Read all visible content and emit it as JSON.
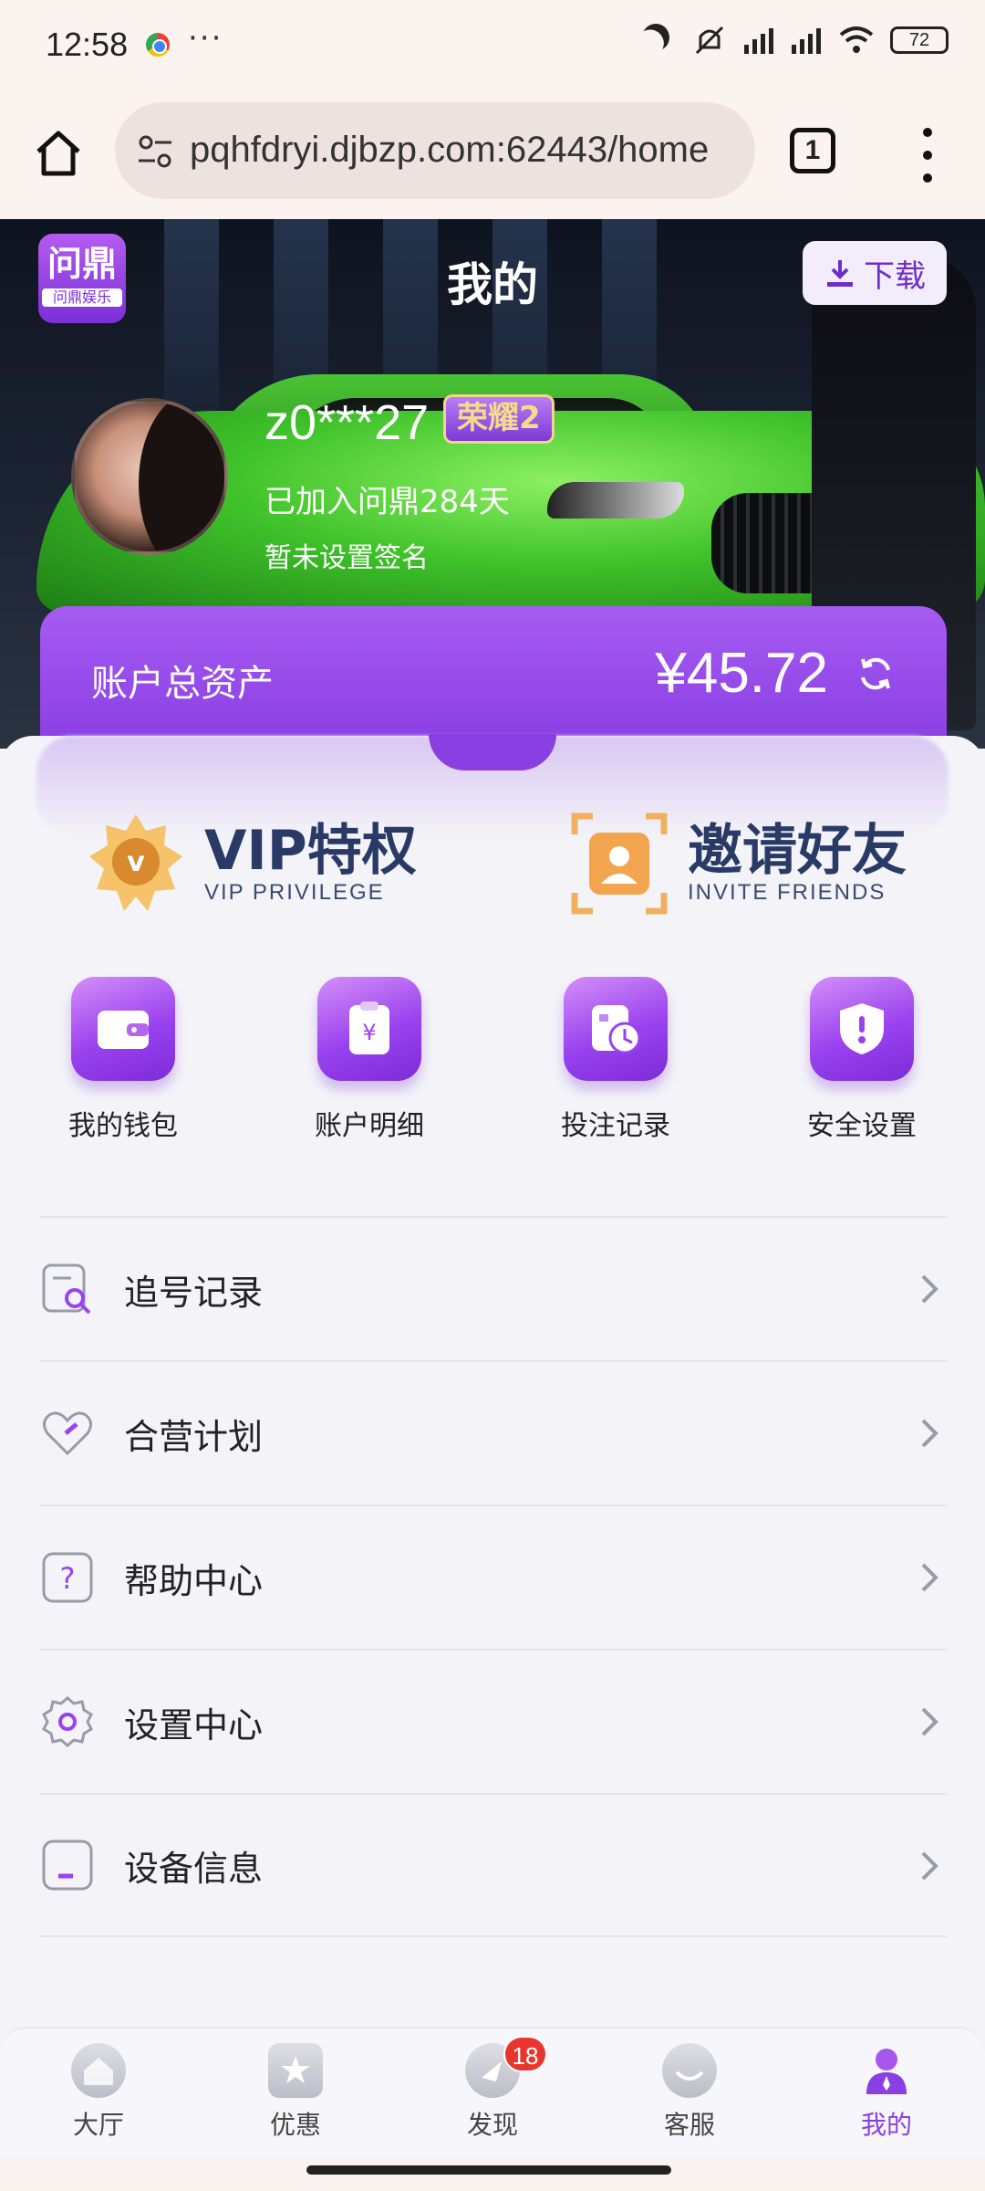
{
  "status_bar": {
    "time": "12:58",
    "more": "···",
    "battery": "72"
  },
  "browser": {
    "url": "pqhfdryi.djbzp.com:62443/home",
    "tab_count": "1"
  },
  "header": {
    "logo_top": "问鼎",
    "logo_bottom": "问鼎娱乐",
    "title": "我的",
    "download_label": "下载"
  },
  "profile": {
    "username": "z0***27",
    "rank": "荣耀2",
    "joined": "已加入问鼎284天",
    "signature": "暂未设置签名"
  },
  "assets": {
    "label": "账户总资产",
    "amount": "¥45.72"
  },
  "promos": [
    {
      "title": "VIP特权",
      "subtitle": "VIP PRIVILEGE"
    },
    {
      "title": "邀请好友",
      "subtitle": "INVITE FRIENDS"
    }
  ],
  "shortcuts": [
    {
      "label": "我的钱包",
      "icon": "wallet-icon"
    },
    {
      "label": "账户明细",
      "icon": "yuan-clipboard-icon"
    },
    {
      "label": "投注记录",
      "icon": "record-clock-icon"
    },
    {
      "label": "安全设置",
      "icon": "shield-icon"
    }
  ],
  "menu": [
    {
      "label": "追号记录",
      "icon": "search-record-icon"
    },
    {
      "label": "合营计划",
      "icon": "heart-icon"
    },
    {
      "label": "帮助中心",
      "icon": "question-icon"
    },
    {
      "label": "设置中心",
      "icon": "gear-icon"
    },
    {
      "label": "设备信息",
      "icon": "device-icon"
    }
  ],
  "bottom_nav": [
    {
      "label": "大厅"
    },
    {
      "label": "优惠"
    },
    {
      "label": "发现",
      "badge": "18"
    },
    {
      "label": "客服"
    },
    {
      "label": "我的"
    }
  ],
  "colors": {
    "accent": "#8a3fe3",
    "navy": "#2a3a66",
    "badge_red": "#e8362f"
  }
}
